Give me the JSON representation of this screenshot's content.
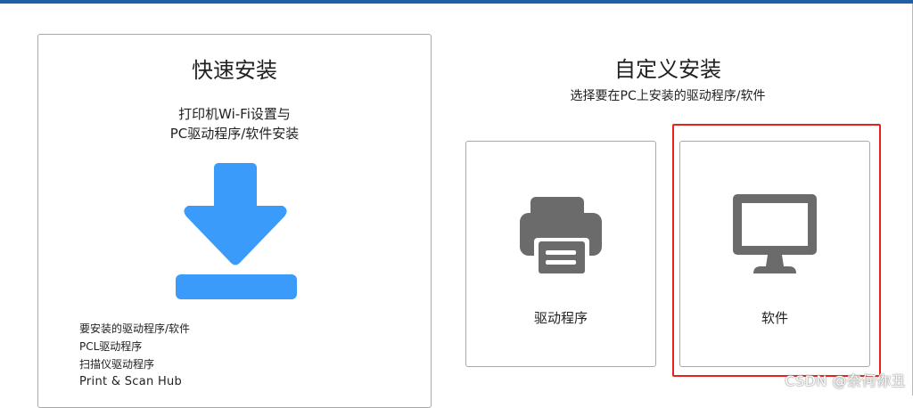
{
  "quick_install": {
    "title": "快速安装",
    "description_line1": "打印机Wi-Fi设置与",
    "description_line2": "PC驱动程序/软件安装",
    "icon": "download-arrow-icon",
    "icon_color": "#3b9bfb",
    "items": [
      "要安装的驱动程序/软件",
      "PCL驱动程序",
      "扫描仪驱动程序",
      "Print & Scan Hub"
    ]
  },
  "custom_install": {
    "title": "自定义安装",
    "subtitle": "选择要在PC上安装的驱动程序/软件",
    "cards": [
      {
        "label": "驱动程序",
        "icon": "printer-icon"
      },
      {
        "label": "软件",
        "icon": "monitor-icon"
      }
    ],
    "icon_color": "#6b6b6b",
    "highlight_color": "#e8211c"
  },
  "watermark": "CSDN @奈何你丑"
}
